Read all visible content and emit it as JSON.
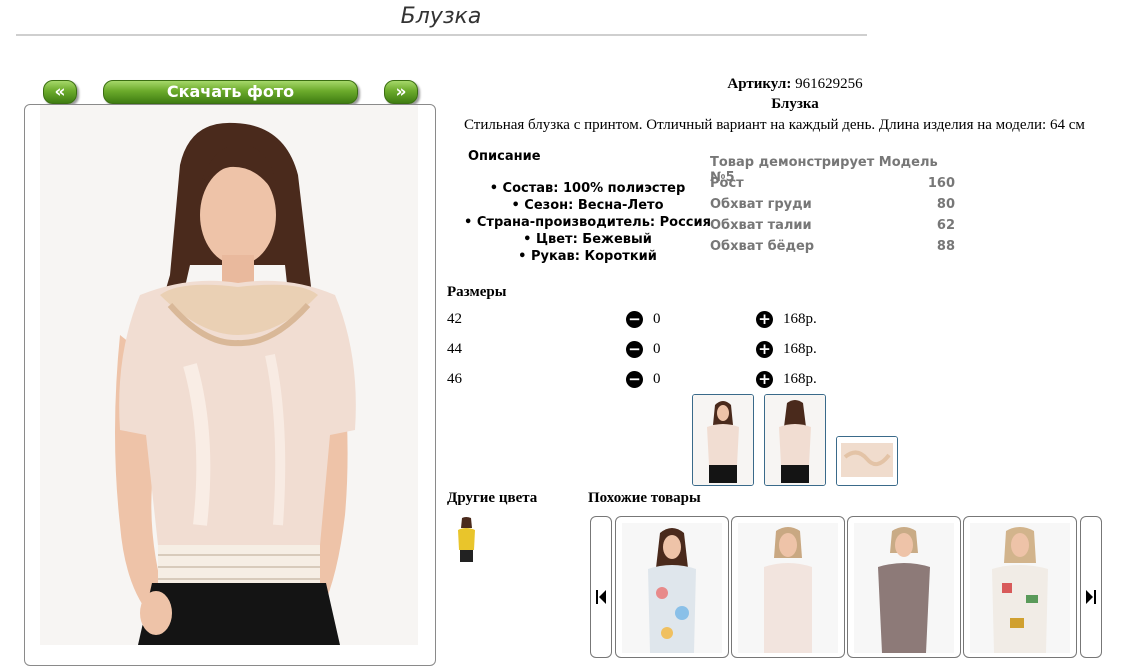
{
  "header": {
    "title": "Блузка"
  },
  "gallery": {
    "prev_label": "«",
    "download_label": "Скачать фото",
    "next_label": "»"
  },
  "product": {
    "article_label": "Артикул:",
    "article_value": "961629256",
    "name": "Блузка",
    "description": "Стильная блузка с принтом. Отличный вариант на каждый день. Длина изделия на модели: 64 см"
  },
  "details": {
    "heading": "Описание",
    "items": [
      "• Состав: 100% полиэстер",
      "• Сезон: Весна-Лето",
      "• Страна-производитель: Россия",
      "• Цвет: Бежевый",
      "• Рукав: Короткий"
    ]
  },
  "model": {
    "heading": "Товар демонстрирует Модель №5",
    "rows": [
      {
        "label": "Рост",
        "value": "160"
      },
      {
        "label": "Обхват груди",
        "value": "80"
      },
      {
        "label": "Обхват талии",
        "value": "62"
      },
      {
        "label": "Обхват бёдер",
        "value": "88"
      }
    ]
  },
  "sizes": {
    "heading": "Размеры",
    "rows": [
      {
        "size": "42",
        "qty": "0",
        "price": "168р."
      },
      {
        "size": "44",
        "qty": "0",
        "price": "168р."
      },
      {
        "size": "46",
        "qty": "0",
        "price": "168р."
      }
    ]
  },
  "other_colors": {
    "heading": "Другие цвета"
  },
  "similar": {
    "heading": "Похожие товары"
  },
  "colors": {
    "accent_green": "#6cab2b",
    "thumb_border": "#3a6a8a",
    "blouse": "#f1ddd2",
    "hair": "#4a2a1c"
  }
}
